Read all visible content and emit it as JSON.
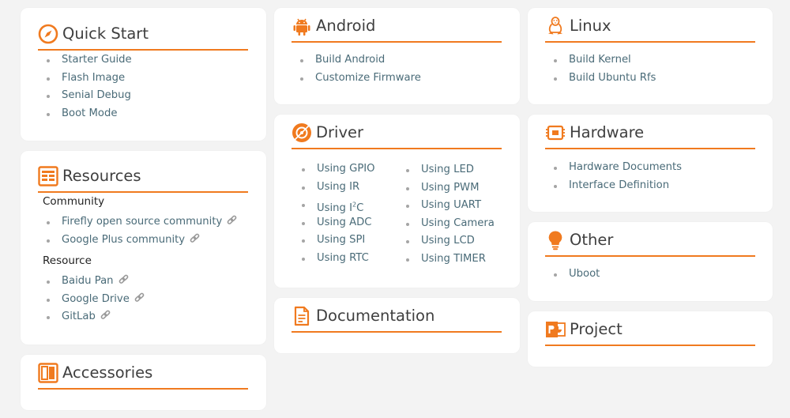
{
  "accent": "#f07a1f",
  "cards": {
    "quick_start": {
      "title": "Quick Start",
      "icon": "compass-icon",
      "items": [
        "Starter Guide",
        "Flash Image",
        "Senial Debug",
        "Boot Mode"
      ]
    },
    "resources": {
      "title": "Resources",
      "icon": "newspaper-icon",
      "community_label": "Community",
      "community_items": [
        "Firefly open source community",
        "Google Plus community"
      ],
      "resource_label": "Resource",
      "resource_items": [
        "Baidu Pan",
        "Google Drive",
        "GitLab"
      ],
      "link_icon": "chain-link-icon"
    },
    "accessories": {
      "title": "Accessories",
      "icon": "panel-icon"
    },
    "android": {
      "title": "Android",
      "icon": "android-icon",
      "items": [
        "Build Android",
        "Customize Firmware"
      ]
    },
    "driver": {
      "title": "Driver",
      "icon": "gear-disc-icon",
      "col1": [
        "Using GPIO",
        "Using IR",
        "Using I",
        "Using ADC",
        "Using SPI",
        "Using RTC"
      ],
      "i2c_sup": "2",
      "i2c_suffix": "C",
      "col2": [
        "Using LED",
        "Using PWM",
        "Using UART",
        "Using Camera",
        "Using LCD",
        "Using TIMER"
      ]
    },
    "documentation": {
      "title": "Documentation",
      "icon": "document-icon"
    },
    "linux": {
      "title": "Linux",
      "icon": "penguin-icon",
      "items": [
        "Build Kernel",
        "Build Ubuntu Rfs"
      ]
    },
    "hardware": {
      "title": "Hardware",
      "icon": "chip-icon",
      "items": [
        "Hardware Documents",
        "Interface Definition"
      ]
    },
    "other": {
      "title": "Other",
      "icon": "lightbulb-icon",
      "items": [
        "Uboot"
      ]
    },
    "project": {
      "title": "Project",
      "icon": "presentation-icon"
    }
  }
}
